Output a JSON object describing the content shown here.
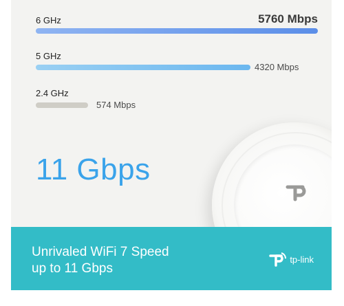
{
  "bands": [
    {
      "label": "6 GHz",
      "value": "5760 Mbps",
      "fraction": 1.0
    },
    {
      "label": "5 GHz",
      "value": "4320 Mbps",
      "fraction": 0.75
    },
    {
      "label": "2.4 GHz",
      "value": "574 Mbps",
      "fraction": 0.2
    }
  ],
  "hero": {
    "text": "11 Gbps"
  },
  "footer": {
    "line1": "Unrivaled WiFi 7 Speed",
    "line2": "up to 11 Gbps"
  },
  "brand": {
    "name": "tp-link"
  },
  "icons": {
    "device_logo": "tp-link-logo-icon",
    "brand_logo": "tp-link-brand-icon"
  },
  "colors": {
    "hero": "#3aa3ea",
    "footer_bg": "#33bcc7",
    "bar_6ghz": "#5b8ee8",
    "bar_5ghz": "#6bb7ef",
    "bar_24ghz": "#cfcdc6"
  }
}
